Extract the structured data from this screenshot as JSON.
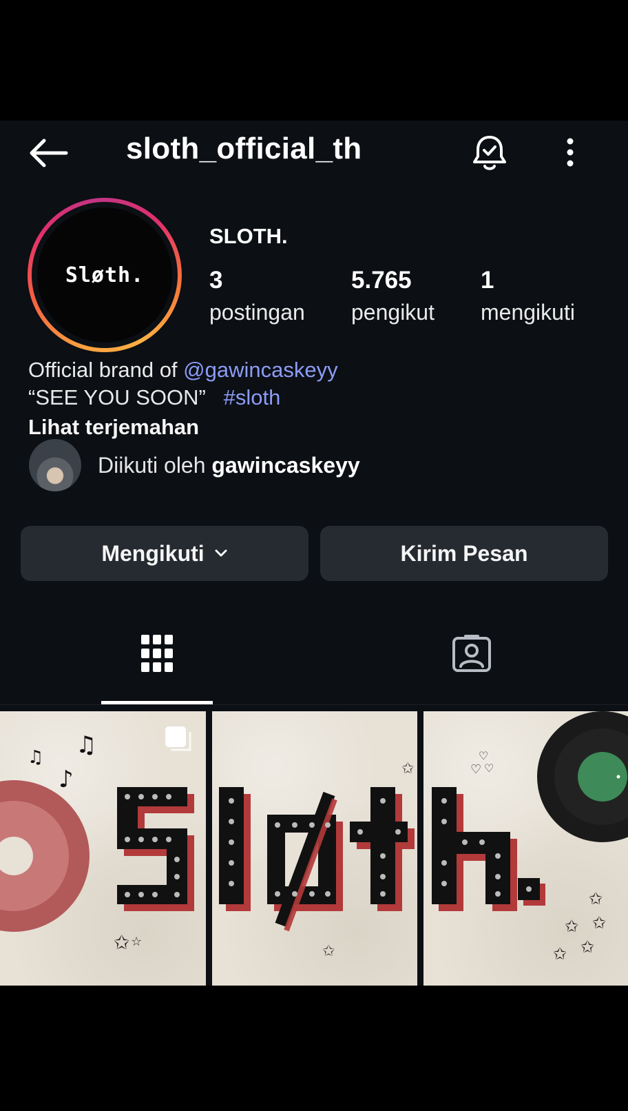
{
  "header": {
    "username": "sloth_official_th",
    "back_icon": "arrow-left-icon",
    "bell_icon": "bell-check-icon",
    "more_icon": "more-vertical-icon"
  },
  "profile": {
    "avatar_text": "Sløth.",
    "display_name": "SLOTH.",
    "stats": [
      {
        "value": "3",
        "label": "postingan"
      },
      {
        "value": "5.765",
        "label": "pengikut"
      },
      {
        "value": "1",
        "label": "mengikuti"
      }
    ],
    "bio_prefix": "Official brand of ",
    "bio_mention": "@gawincaskeyy",
    "bio_line2_text": "“SEE YOU SOON”",
    "bio_hashtag": "#sloth",
    "translate_label": "Lihat terjemahan",
    "followed_by_prefix": "Diikuti oleh ",
    "followed_by_user": "gawincaskeyy"
  },
  "actions": {
    "follow_label": "Mengikuti",
    "message_label": "Kirim Pesan"
  },
  "tabs": [
    {
      "name": "grid",
      "icon": "grid-icon",
      "active": true
    },
    {
      "name": "tagged",
      "icon": "tagged-person-icon",
      "active": false
    }
  ],
  "posts": [
    {
      "letters": "Sl",
      "overlay_icon": "carousel-icon"
    },
    {
      "letters": "øt"
    },
    {
      "letters": "h."
    }
  ],
  "colors": {
    "background": "#0c0f14",
    "button": "#262a31",
    "link": "#8c9cf7",
    "poster_red": "#b23a3a",
    "poster_paper": "#e7e1d6"
  }
}
